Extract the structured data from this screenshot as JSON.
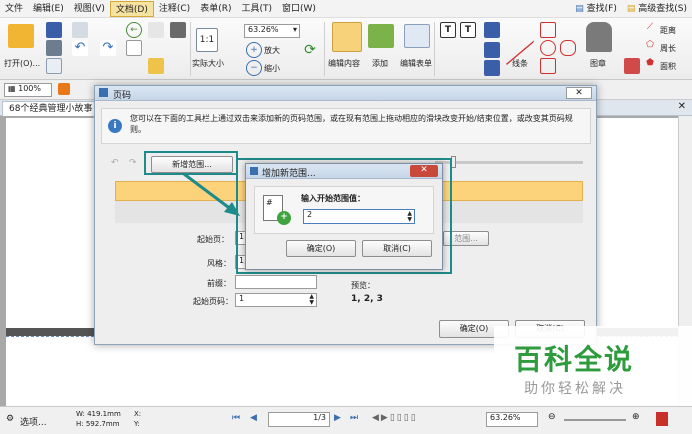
{
  "menubar": {
    "items": [
      "文件",
      "编辑(E)",
      "视图(V)",
      "文档(D)",
      "注释(C)",
      "表单(R)",
      "工具(T)",
      "窗口(W)"
    ],
    "right": [
      "查找(F)",
      "高级查找(S)"
    ]
  },
  "ribbon": {
    "open": "打开(O)...",
    "zoom_value": "63.26%",
    "actual_size": "实际大小",
    "zoom_in": "放大",
    "zoom_out": "缩小",
    "edit_content": "编辑内容",
    "add": "添加",
    "edit_form": "编辑表单",
    "line": "线条",
    "stamp": "图章",
    "distance": "距离",
    "perimeter": "周长",
    "area": "面积"
  },
  "toolbar2": {
    "zoom": "100%"
  },
  "tab": {
    "label": "68个经典管理小故事 *"
  },
  "dialog": {
    "title": "页码",
    "info": "您可以在下面的工具栏上通过双击来添加新的页码范围，或在现有范围上拖动相应的滑块改变开始/结束位置，或改变其页码规则。",
    "add_range_btn": "新增范围...",
    "start_label": "起始页：",
    "start_value": "1",
    "style_label": "风格：",
    "style_value": "1,",
    "prefix_label": "前缀：",
    "prefix_value": "",
    "start_num_label": "起始页码：",
    "start_num_value": "1",
    "preview_label": "预览：",
    "preview_value": "1, 2, 3",
    "range_btn": "范围...",
    "ok": "确定(O)",
    "cancel": "取消(C)"
  },
  "subdialog": {
    "title": "增加新范围...",
    "prompt": "输入开始范围值：",
    "value": "2",
    "ok": "确定(O)",
    "cancel": "取消(C)"
  },
  "status": {
    "options": "选项...",
    "w": "W: 419.1mm",
    "h": "H: 592.7mm",
    "x": "X:",
    "y": "Y:",
    "page": "1/3",
    "zoom": "63.26%"
  },
  "watermark": {
    "title": "百科全说",
    "subtitle": "助你轻松解决"
  },
  "colors": {
    "highlight": "#1f8a8a",
    "range_bar": "#fcd37a",
    "menu_active": "#f7e3a1"
  }
}
